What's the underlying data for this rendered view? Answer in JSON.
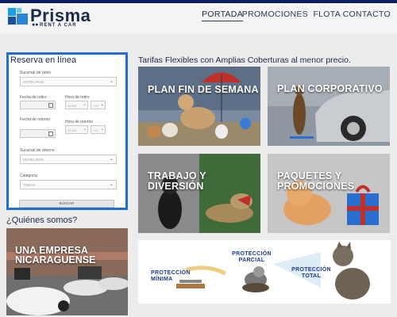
{
  "brand": {
    "name": "Prisma",
    "sub": "RENT A CAR"
  },
  "nav": {
    "items": [
      "PORTADA",
      "PROMOCIONES",
      "FLOTA",
      "CONTACTO"
    ],
    "active": "PORTADA"
  },
  "booking": {
    "title": "Reserva en línea",
    "sucursal_retiro_label": "Sucursal de retiro",
    "sucursal_retiro_value": "HOTEL ROG",
    "fecha_retiro_label": "Fecha de retiro",
    "hora_retiro_label": "Hora de retiro",
    "hora_retiro_value": "08 AM",
    "min_retiro_value": ": 00",
    "fecha_retorno_label": "Fecha de retorno",
    "hora_retorno_label": "Hora de retorno",
    "hora_retorno_value": "08 AM",
    "min_retorno_value": ": 00",
    "sucursal_retorno_label": "Sucursal de retorno",
    "sucursal_retorno_value": "HOTEL ROG",
    "categoria_label": "Categoría",
    "categoria_value": "TODAS",
    "search_button": "BUSCAR"
  },
  "tagline": "Tarifas Flexibles con Amplias Coberturas al menor precio.",
  "tiles": {
    "fin_semana": "PLAN FIN DE SEMANA",
    "corporativo": "PLAN CORPORATIVO",
    "trabajo": "TRABAJO Y DIVERSIÓN",
    "paquetes": "PAQUETES Y PROMOCIONES"
  },
  "about": {
    "heading": "¿Quiénes somos?",
    "banner": "UNA EMPRESA NICARAGUENSE"
  },
  "protection": {
    "minima": "PROTECCIÓN MÍNIMA",
    "parcial": "PROTECCIÓN PARCIAL",
    "total": "PROTECCIÓN TOTAL"
  },
  "colors": {
    "accent": "#1f6fd0",
    "brand_dark": "#1b2a4a",
    "top_bar": "#0d1f5c",
    "protection_text": "#1b3a8a"
  }
}
